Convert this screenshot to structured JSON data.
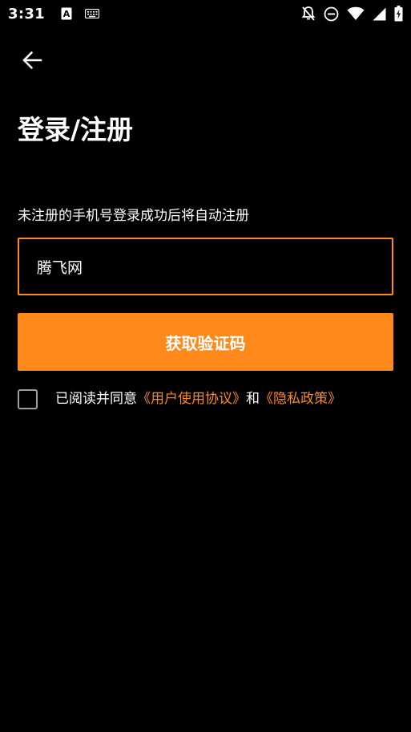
{
  "status_bar": {
    "time": "3:31",
    "icons_left": [
      "text-a-icon",
      "keyboard-icon"
    ],
    "icons_right": [
      "notifications-off-icon",
      "do-not-disturb-icon",
      "wifi-icon",
      "signal-icon",
      "battery-charging-icon"
    ]
  },
  "colors": {
    "accent": "#ff8a1b",
    "background": "#000000",
    "text": "#ffffff",
    "checkbox_border": "#9e9e9e"
  },
  "header": {
    "back_icon": "arrow-left-icon",
    "title": "登录/注册"
  },
  "form": {
    "hint": "未注册的手机号登录成功后将自动注册",
    "phone_value": "腾飞网",
    "get_code_label": "获取验证码",
    "agreement": {
      "checked": false,
      "prefix": "已阅读并同意",
      "user_agreement": "《用户使用协议》",
      "conjunction": "和",
      "privacy_policy": "《隐私政策》"
    }
  }
}
